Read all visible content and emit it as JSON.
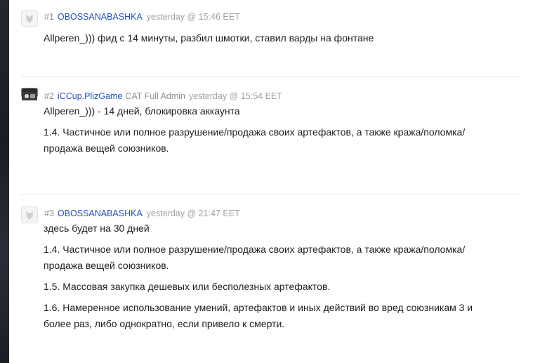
{
  "posts": [
    {
      "num": "#1",
      "author": "OBOSSANABASHKA",
      "role": "",
      "time": "yesterday @ 15:46 EET",
      "lines": [
        "Allperen_))) фид с 14 минуты, разбил шмотки, ставил варды на фонтане"
      ]
    },
    {
      "num": "#2",
      "author": "iCCup.PlizGame",
      "role": "CAT Full Admin",
      "time": "yesterday @ 15:54 EET",
      "lines": [
        "Allperen_))) - 14 дней, блокировка аккаунта",
        "1.4. Частичное или полное разрушение/продажа своих артефактов, а также кража/поломка/",
        "продажа вещей союзников."
      ]
    },
    {
      "num": "#3",
      "author": "OBOSSANABASHKA",
      "role": "",
      "time": "yesterday @ 21:47 EET",
      "lines": [
        "здесь будет на 30 дней",
        "1.4. Частичное или полное разрушение/продажа своих артефактов, а также кража/поломка/",
        "продажа вещей союзников.",
        "1.5. Массовая закупка дешевых или бесполезных артефактов.",
        "1.6. Намеренное использование умений, артефактов и иных действий во вред союзникам 3 и",
        "более раз, либо однократно, если привело к смерти."
      ]
    }
  ]
}
